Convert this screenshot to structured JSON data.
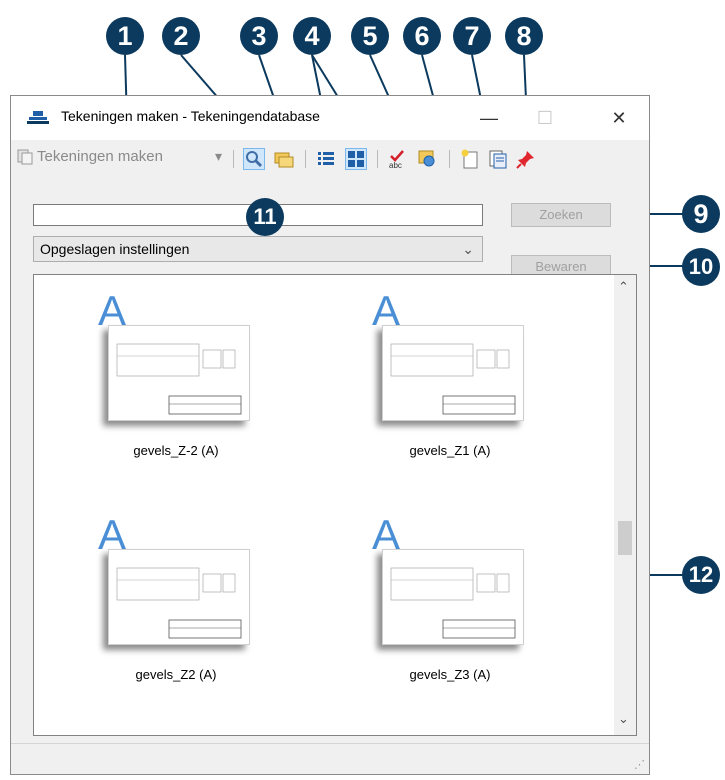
{
  "callouts": [
    "1",
    "2",
    "3",
    "4",
    "5",
    "6",
    "7",
    "8",
    "9",
    "10",
    "11",
    "12"
  ],
  "window": {
    "title": "Tekeningen maken - Tekeningendatabase",
    "minimize_glyph": "—",
    "maximize_glyph": "☐",
    "close_glyph": "✕"
  },
  "toolbar": {
    "mode_label": "Tekeningen maken",
    "mode_dropdown_glyph": "▾",
    "icons": [
      "search-icon",
      "folder-icon",
      "list-view-icon",
      "thumbnail-view-icon",
      "spellcheck-icon",
      "replace-icon",
      "new-document-icon",
      "document-properties-icon",
      "pin-icon"
    ]
  },
  "search": {
    "placeholder": "",
    "button_label": "Zoeken"
  },
  "settings": {
    "selected": "Opgeslagen instellingen",
    "save_label": "Bewaren"
  },
  "drawings": [
    {
      "label": "gevels_Z-2 (A)",
      "letter": "A"
    },
    {
      "label": "gevels_Z1 (A)",
      "letter": "A"
    },
    {
      "label": "gevels_Z2 (A)",
      "letter": "A"
    },
    {
      "label": "gevels_Z3 (A)",
      "letter": "A"
    }
  ],
  "colors": {
    "callout": "#0b3a5e",
    "accent": "#4a8fd6"
  }
}
